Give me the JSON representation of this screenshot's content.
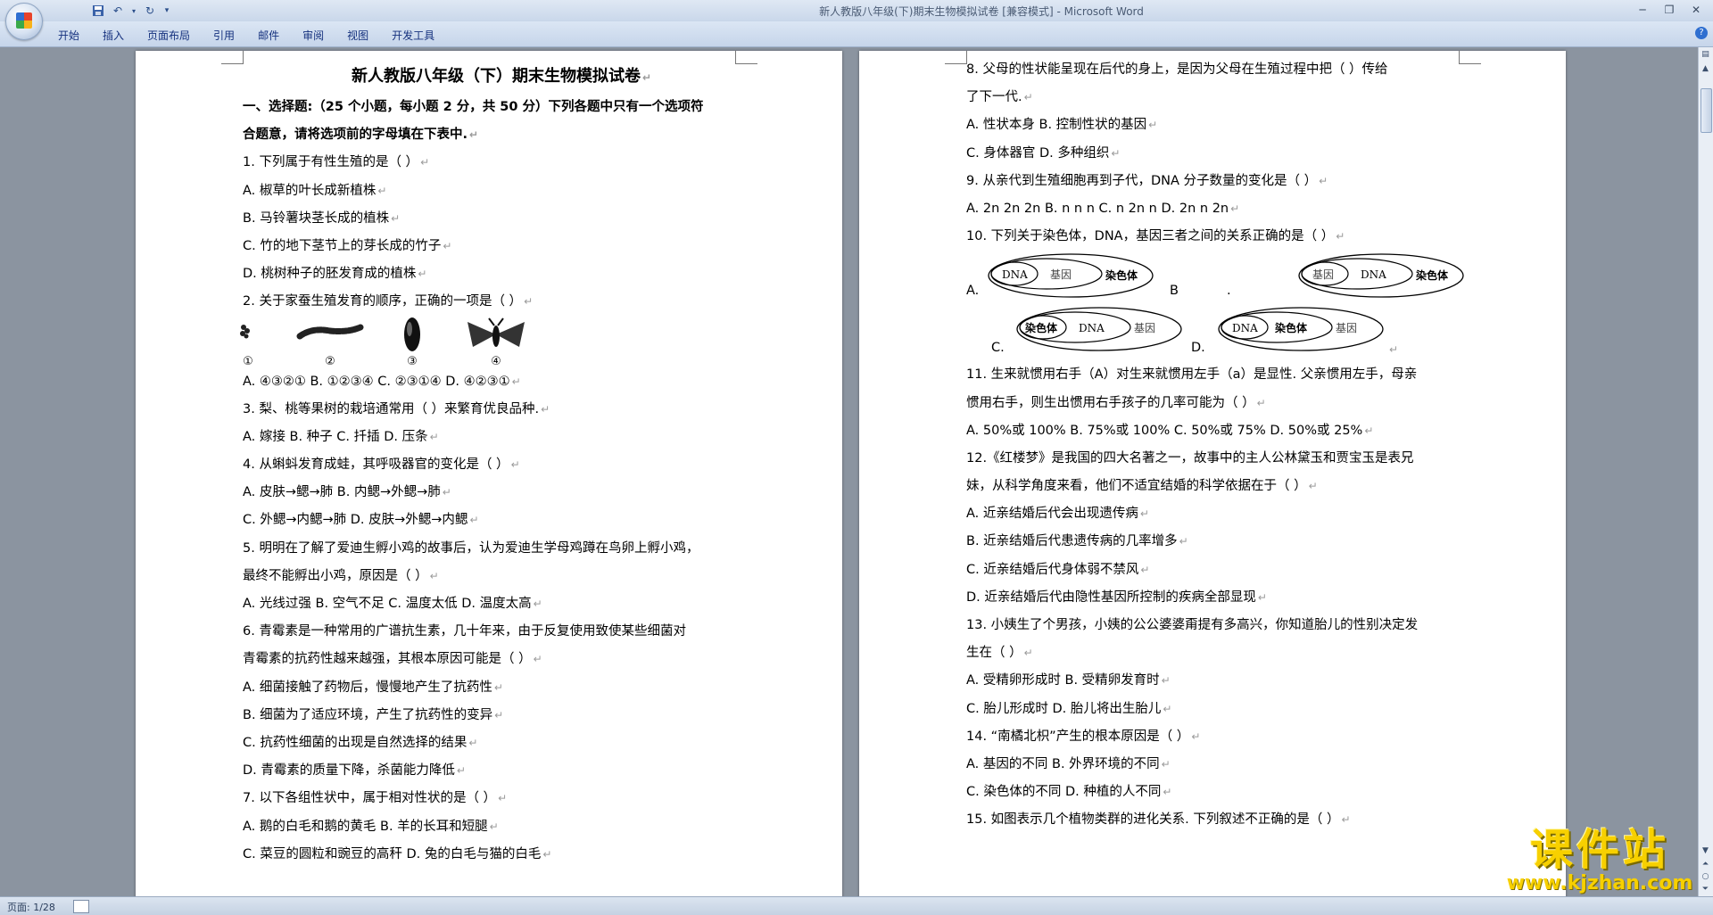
{
  "window": {
    "title": "新人教版八年级(下)期末生物模拟试卷 [兼容模式] - Microsoft Word",
    "ribbon_tabs": [
      "开始",
      "插入",
      "页面布局",
      "引用",
      "邮件",
      "审阅",
      "视图",
      "开发工具"
    ]
  },
  "statusbar": {
    "page": "页面: 1/28"
  },
  "watermark": {
    "main": "课件站",
    "url": "www.kjzhan.com"
  },
  "left_page": {
    "title": "新人教版八年级（下）期末生物模拟试卷",
    "instructions": [
      "一、选择题:（25 个小题，每小题 2 分，共 50 分）下列各题中只有一个选项符",
      "合题意，请将选项前的字母填在下表中."
    ],
    "lines_a": [
      "1.  下列属于有性生殖的是（      ）",
      "A.  椒草的叶长成新植株",
      "B.  马铃薯块茎长成的植株",
      "C.  竹的地下茎节上的芽长成的竹子",
      "D.  桃树种子的胚发育成的植株",
      "2.  关于家蚕生殖发育的顺序，正确的一项是（      ）"
    ],
    "figure_labels": [
      "①",
      "②",
      "③",
      "④"
    ],
    "lines_b": [
      "A.  ④③②①     B.  ①②③④     C.  ②③①④     D.  ④②③①",
      "3.  梨、桃等果树的栽培通常用（      ）来繁育优良品种.",
      "A.  嫁接     B.  种子     C.  扦插     D.  压条",
      "4.  从蝌蚪发育成蛙，其呼吸器官的变化是（      ）",
      "A.  皮肤→鳃→肺     B.  内鳃→外鳃→肺",
      "C.  外鳃→内鳃→肺  D.  皮肤→外鳃→内鳃",
      "5.  明明在了解了爱迪生孵小鸡的故事后，认为爱迪生学母鸡蹲在鸟卵上孵小鸡，",
      "最终不能孵出小鸡，原因是（      ）",
      "A.  光线过强     B.  空气不足     C.  温度太低     D.  温度太高",
      "6.  青霉素是一种常用的广谱抗生素，几十年来，由于反复使用致使某些细菌对",
      "青霉素的抗药性越来越强，其根本原因可能是（      ）",
      "A.  细菌接触了药物后，慢慢地产生了抗药性",
      "B.  细菌为了适应环境，产生了抗药性的变异",
      "C.  抗药性细菌的出现是自然选择的结果",
      "D.  青霉素的质量下降，杀菌能力降低",
      "7.  以下各组性状中，属于相对性状的是（      ）",
      "A.  鹅的白毛和鹅的黄毛     B.  羊的长耳和短腿",
      "C.  菜豆的圆粒和豌豆的高秆     D.  兔的白毛与猫的白毛"
    ]
  },
  "right_page": {
    "lines_a": [
      "8.  父母的性状能呈现在后代的身上，是因为父母在生殖过程中把（      ）传给",
      "了下一代.",
      "A.  性状本身     B.  控制性状的基因",
      "C.  身体器官     D.  多种组织",
      "9.  从亲代到生殖细胞再到子代，DNA 分子数量的变化是（      ）",
      "A.  2n 2n 2n B.  n n n      C.  n 2n n     D.  2n n 2n",
      "10.  下列关于染色体，DNA，基因三者之间的关系正确的是（      ）"
    ],
    "venn": {
      "A": {
        "letter": "A.",
        "inner": "DNA",
        "middle": "基因",
        "outer": "染色体"
      },
      "B": {
        "letter": "B",
        "dot": ".",
        "inner": "基因",
        "middle": "DNA",
        "outer": "染色体"
      },
      "C": {
        "letter": "C.",
        "inner": "染色体",
        "middle": "DNA",
        "outer": "基因"
      },
      "D": {
        "letter": "D.",
        "inner": "DNA",
        "middle": "染色体",
        "outer": "基因"
      }
    },
    "lines_b": [
      "11.  生来就惯用右手（A）对生来就惯用左手（a）是显性. 父亲惯用左手，母亲",
      "惯用右手，则生出惯用右手孩子的几率可能为（      ）",
      "A.  50%或 100% B.  75%或 100% C.  50%或 75%   D.  50%或 25%",
      "12.《红楼梦》是我国的四大名著之一，故事中的主人公林黛玉和贾宝玉是表兄",
      "妹，从科学角度来看，他们不适宜结婚的科学依据在于（      ）",
      "A.  近亲结婚后代会出现遗传病",
      "B.  近亲结婚后代患遗传病的几率增多",
      "C.  近亲结婚后代身体弱不禁风",
      "D.  近亲结婚后代由隐性基因所控制的疾病全部显现",
      "13.  小姨生了个男孩，小姨的公公婆婆甭提有多高兴，你知道胎儿的性别决定发",
      "生在（      ）",
      "A.  受精卵形成时     B.  受精卵发育时",
      "C.  胎儿形成时  D.  胎儿将出生胎儿",
      "14.  “南橘北枳”产生的根本原因是（      ）",
      "A.  基因的不同  B.  外界环境的不同",
      "C.  染色体的不同     D.  种植的人不同",
      "15.  如图表示几个植物类群的进化关系. 下列叙述不正确的是（      ）"
    ]
  }
}
